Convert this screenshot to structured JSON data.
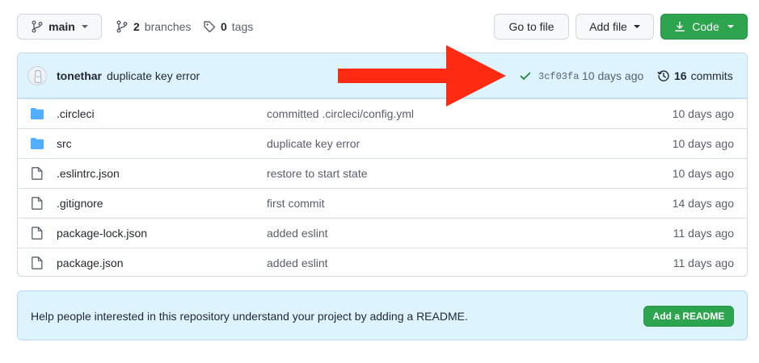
{
  "toolbar": {
    "branch_label": "main",
    "branches_count": "2",
    "branches_label": "branches",
    "tags_count": "0",
    "tags_label": "tags",
    "go_to_file_label": "Go to file",
    "add_file_label": "Add file",
    "code_label": "Code"
  },
  "latest_commit": {
    "author": "tonethar",
    "message": "duplicate key error",
    "sha": "3cf03fa",
    "time": "10 days ago",
    "commits_count": "16",
    "commits_label": "commits"
  },
  "files": [
    {
      "type": "folder",
      "name": ".circleci",
      "message": "committed .circleci/config.yml",
      "age": "10 days ago"
    },
    {
      "type": "folder",
      "name": "src",
      "message": "duplicate key error",
      "age": "10 days ago"
    },
    {
      "type": "file",
      "name": ".eslintrc.json",
      "message": "restore to start state",
      "age": "10 days ago"
    },
    {
      "type": "file",
      "name": ".gitignore",
      "message": "first commit",
      "age": "14 days ago"
    },
    {
      "type": "file",
      "name": "package-lock.json",
      "message": "added eslint",
      "age": "11 days ago"
    },
    {
      "type": "file",
      "name": "package.json",
      "message": "added eslint",
      "age": "11 days ago"
    }
  ],
  "readme_banner": {
    "text": "Help people interested in this repository understand your project by adding a README.",
    "button_label": "Add a README"
  },
  "colors": {
    "primary_green": "#2da44e",
    "folder_blue": "#54aeff",
    "annotation_red": "#ff2a12",
    "commit_banner_bg": "#ddf4ff"
  },
  "annotation": {
    "icon": "red-arrow-pointing-right"
  }
}
